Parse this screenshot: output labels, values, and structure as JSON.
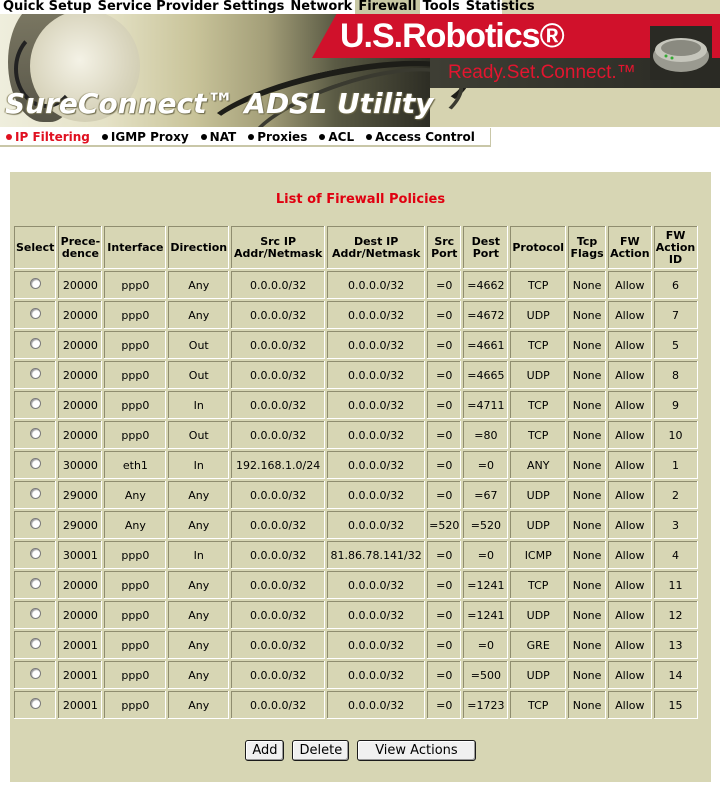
{
  "top_menu": {
    "items": [
      {
        "label": "Quick Setup"
      },
      {
        "label": "Service Provider Settings"
      },
      {
        "label": "Network"
      },
      {
        "label": "Firewall",
        "active": true
      },
      {
        "label": "Tools"
      },
      {
        "label": "Statistics"
      }
    ]
  },
  "banner": {
    "brand": "U.S.Robotics®",
    "tagline": "Ready.Set.Connect.™",
    "product": "SureConnect™ ADSL Utility"
  },
  "sub_nav": {
    "items": [
      {
        "label": "IP Filtering",
        "active": true
      },
      {
        "label": "IGMP Proxy"
      },
      {
        "label": "NAT"
      },
      {
        "label": "Proxies"
      },
      {
        "label": "ACL"
      },
      {
        "label": "Access Control"
      }
    ]
  },
  "firewall": {
    "title": "List of Firewall Policies",
    "columns": {
      "select": "Select",
      "precedence_1": "Prece-",
      "precedence_2": "dence",
      "interface": "Interface",
      "direction": "Direction",
      "src_ip_1": "Src IP",
      "src_ip_2": "Addr/Netmask",
      "dest_ip_1": "Dest IP",
      "dest_ip_2": "Addr/Netmask",
      "src_port_1": "Src",
      "src_port_2": "Port",
      "dest_port_1": "Dest",
      "dest_port_2": "Port",
      "protocol": "Protocol",
      "tcp_flags_1": "Tcp",
      "tcp_flags_2": "Flags",
      "fw_action_1": "FW",
      "fw_action_2": "Action",
      "fw_action_id_1": "FW",
      "fw_action_id_2": "Action",
      "fw_action_id_3": "ID"
    },
    "rows": [
      {
        "precedence": "20000",
        "interface": "ppp0",
        "direction": "Any",
        "src_ip": "0.0.0.0/32",
        "dest_ip": "0.0.0.0/32",
        "src_port": "=0",
        "dest_port": "=4662",
        "protocol": "TCP",
        "tcp_flags": "None",
        "fw_action": "Allow",
        "fw_action_id": "6"
      },
      {
        "precedence": "20000",
        "interface": "ppp0",
        "direction": "Any",
        "src_ip": "0.0.0.0/32",
        "dest_ip": "0.0.0.0/32",
        "src_port": "=0",
        "dest_port": "=4672",
        "protocol": "UDP",
        "tcp_flags": "None",
        "fw_action": "Allow",
        "fw_action_id": "7"
      },
      {
        "precedence": "20000",
        "interface": "ppp0",
        "direction": "Out",
        "src_ip": "0.0.0.0/32",
        "dest_ip": "0.0.0.0/32",
        "src_port": "=0",
        "dest_port": "=4661",
        "protocol": "TCP",
        "tcp_flags": "None",
        "fw_action": "Allow",
        "fw_action_id": "5"
      },
      {
        "precedence": "20000",
        "interface": "ppp0",
        "direction": "Out",
        "src_ip": "0.0.0.0/32",
        "dest_ip": "0.0.0.0/32",
        "src_port": "=0",
        "dest_port": "=4665",
        "protocol": "UDP",
        "tcp_flags": "None",
        "fw_action": "Allow",
        "fw_action_id": "8"
      },
      {
        "precedence": "20000",
        "interface": "ppp0",
        "direction": "In",
        "src_ip": "0.0.0.0/32",
        "dest_ip": "0.0.0.0/32",
        "src_port": "=0",
        "dest_port": "=4711",
        "protocol": "TCP",
        "tcp_flags": "None",
        "fw_action": "Allow",
        "fw_action_id": "9"
      },
      {
        "precedence": "20000",
        "interface": "ppp0",
        "direction": "Out",
        "src_ip": "0.0.0.0/32",
        "dest_ip": "0.0.0.0/32",
        "src_port": "=0",
        "dest_port": "=80",
        "protocol": "TCP",
        "tcp_flags": "None",
        "fw_action": "Allow",
        "fw_action_id": "10"
      },
      {
        "precedence": "30000",
        "interface": "eth1",
        "direction": "In",
        "src_ip": "192.168.1.0/24",
        "dest_ip": "0.0.0.0/32",
        "src_port": "=0",
        "dest_port": "=0",
        "protocol": "ANY",
        "tcp_flags": "None",
        "fw_action": "Allow",
        "fw_action_id": "1"
      },
      {
        "precedence": "29000",
        "interface": "Any",
        "direction": "Any",
        "src_ip": "0.0.0.0/32",
        "dest_ip": "0.0.0.0/32",
        "src_port": "=0",
        "dest_port": "=67",
        "protocol": "UDP",
        "tcp_flags": "None",
        "fw_action": "Allow",
        "fw_action_id": "2"
      },
      {
        "precedence": "29000",
        "interface": "Any",
        "direction": "Any",
        "src_ip": "0.0.0.0/32",
        "dest_ip": "0.0.0.0/32",
        "src_port": "=520",
        "dest_port": "=520",
        "protocol": "UDP",
        "tcp_flags": "None",
        "fw_action": "Allow",
        "fw_action_id": "3"
      },
      {
        "precedence": "30001",
        "interface": "ppp0",
        "direction": "In",
        "src_ip": "0.0.0.0/32",
        "dest_ip": "81.86.78.141/32",
        "src_port": "=0",
        "dest_port": "=0",
        "protocol": "ICMP",
        "tcp_flags": "None",
        "fw_action": "Allow",
        "fw_action_id": "4"
      },
      {
        "precedence": "20000",
        "interface": "ppp0",
        "direction": "Any",
        "src_ip": "0.0.0.0/32",
        "dest_ip": "0.0.0.0/32",
        "src_port": "=0",
        "dest_port": "=1241",
        "protocol": "TCP",
        "tcp_flags": "None",
        "fw_action": "Allow",
        "fw_action_id": "11"
      },
      {
        "precedence": "20000",
        "interface": "ppp0",
        "direction": "Any",
        "src_ip": "0.0.0.0/32",
        "dest_ip": "0.0.0.0/32",
        "src_port": "=0",
        "dest_port": "=1241",
        "protocol": "UDP",
        "tcp_flags": "None",
        "fw_action": "Allow",
        "fw_action_id": "12"
      },
      {
        "precedence": "20001",
        "interface": "ppp0",
        "direction": "Any",
        "src_ip": "0.0.0.0/32",
        "dest_ip": "0.0.0.0/32",
        "src_port": "=0",
        "dest_port": "=0",
        "protocol": "GRE",
        "tcp_flags": "None",
        "fw_action": "Allow",
        "fw_action_id": "13"
      },
      {
        "precedence": "20001",
        "interface": "ppp0",
        "direction": "Any",
        "src_ip": "0.0.0.0/32",
        "dest_ip": "0.0.0.0/32",
        "src_port": "=0",
        "dest_port": "=500",
        "protocol": "UDP",
        "tcp_flags": "None",
        "fw_action": "Allow",
        "fw_action_id": "14"
      },
      {
        "precedence": "20001",
        "interface": "ppp0",
        "direction": "Any",
        "src_ip": "0.0.0.0/32",
        "dest_ip": "0.0.0.0/32",
        "src_port": "=0",
        "dest_port": "=1723",
        "protocol": "TCP",
        "tcp_flags": "None",
        "fw_action": "Allow",
        "fw_action_id": "15"
      }
    ]
  },
  "buttons": {
    "add": "Add",
    "delete": "Delete",
    "view_actions": "View Actions"
  },
  "colors": {
    "panel_bg": "#d7d6b4",
    "accent_red": "#e00010",
    "brand_red": "#d0112b"
  }
}
